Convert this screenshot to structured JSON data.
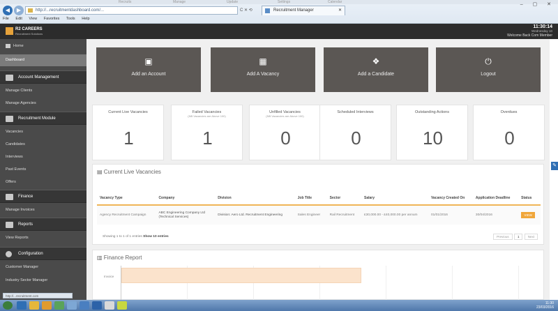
{
  "browser": {
    "address": "http://...recruitmentdashboard.com/...",
    "tab_title": "Recruitment Manager",
    "controls": "C ✕ ⟲",
    "menu": [
      "File",
      "Edit",
      "View",
      "Favorites",
      "Tools",
      "Help"
    ],
    "window_controls": "– ▢ ✕",
    "top_strip": [
      "Recruits",
      "Manage",
      "Update",
      "Settings",
      "Calendar"
    ]
  },
  "header": {
    "logo_name": "R2 CAREERS",
    "logo_tag": "Recruitment Solutions",
    "time": "11:30:14",
    "date": "Wednesday 10",
    "welcome": "Welcome Back Com Member"
  },
  "sidebar": {
    "home_label": "Home",
    "dashboard_label": "Dashboard",
    "sections": [
      {
        "label": "Account Management",
        "items": [
          "Manage Clients",
          "Manage Agencies"
        ]
      },
      {
        "label": "Recruitment Module",
        "items": [
          "Vacancies",
          "Candidates",
          "Interviews",
          "Past Events",
          "Offers"
        ]
      },
      {
        "label": "Finance",
        "items": [
          "Manage Invoices"
        ]
      },
      {
        "label": "Reports",
        "items": [
          "View Reports"
        ]
      },
      {
        "label": "Configuration",
        "items": [
          "Customer Manager",
          "Industry Sector Manager"
        ]
      }
    ]
  },
  "actions": [
    {
      "label": "Add an Account",
      "icon": "address-book-icon",
      "glyph": "▣"
    },
    {
      "label": "Add A Vacancy",
      "icon": "vacancy-icon",
      "glyph": "▦"
    },
    {
      "label": "Add a Candidate",
      "icon": "users-icon",
      "glyph": "❖"
    },
    {
      "label": "Logout",
      "icon": "power-icon",
      "glyph": "⏻"
    }
  ],
  "stats": [
    {
      "title": "Current Live Vacancies",
      "sub": "",
      "value": "1"
    },
    {
      "title": "Failed Vacancies",
      "sub": "(NB Vacancies are Above 100)",
      "value": "1"
    },
    {
      "title": "Unfilled Vacancies",
      "sub": "(NB Vacancies are Above 100)",
      "value": "0"
    },
    {
      "title": "Scheduled Interviews",
      "sub": "",
      "value": "0"
    },
    {
      "title": "Outstanding Actions",
      "sub": "",
      "value": "10"
    },
    {
      "title": "Overdues",
      "sub": "",
      "value": "0"
    }
  ],
  "vacancies": {
    "title": "Current Live Vacancies",
    "columns": [
      "Vacancy Type",
      "Company",
      "Division",
      "Job Title",
      "Sector",
      "Salary",
      "Vacancy Created On",
      "Application Deadline",
      "Status"
    ],
    "rows": [
      {
        "type": "Agency Recruitment Campaign",
        "company": "ABC Engineering Company Ltd",
        "company_sub": "(Technical Services)",
        "division": "Division: Aero Ltd. Recruitment Engineering",
        "job_title": "Sales Engineer",
        "sector": "Rail Recruitment",
        "salary": "£30,000.00 - £40,000.00 per annum",
        "created": "01/01/2016",
        "deadline": "30/04/2016",
        "status": "VIEW"
      }
    ],
    "info_prefix": "Showing 1 to 1 of 1 entries",
    "info_show": "Show",
    "info_count": "10",
    "info_suffix": "entries",
    "pager": [
      "Previous",
      "1",
      "Next"
    ]
  },
  "finance": {
    "title": "Finance Report",
    "y_label": "Invoice"
  },
  "taskbar": {
    "time": "11:30",
    "date": "23/03/2016"
  },
  "status_bar": "http://...recruitment.com"
}
